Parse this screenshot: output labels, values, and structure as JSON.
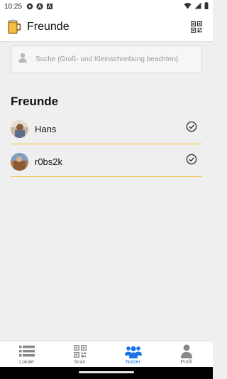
{
  "status_bar": {
    "time": "10:25"
  },
  "app_bar": {
    "title": "Freunde",
    "logo_icon": "beer-mug-icon",
    "action_icon": "qr-code-icon"
  },
  "search": {
    "placeholder": "Suche (Groß- und Kleinschreibung beachten)",
    "value": "",
    "icon": "person-icon"
  },
  "friends": {
    "heading": "Freunde",
    "items": [
      {
        "name": "Hans",
        "status_icon": "check-circle-icon"
      },
      {
        "name": "r0bs2k",
        "status_icon": "check-circle-icon"
      }
    ]
  },
  "bottom_nav": {
    "items": [
      {
        "label": "Lokale",
        "icon": "list-icon",
        "active": false
      },
      {
        "label": "Scan",
        "icon": "qr-code-icon",
        "active": false
      },
      {
        "label": "Nutzer",
        "icon": "users-icon",
        "active": true
      },
      {
        "label": "Profil",
        "icon": "person-icon",
        "active": false
      }
    ]
  },
  "colors": {
    "accent": "#f2c12e",
    "active": "#1a73e8",
    "background": "#efefef"
  }
}
